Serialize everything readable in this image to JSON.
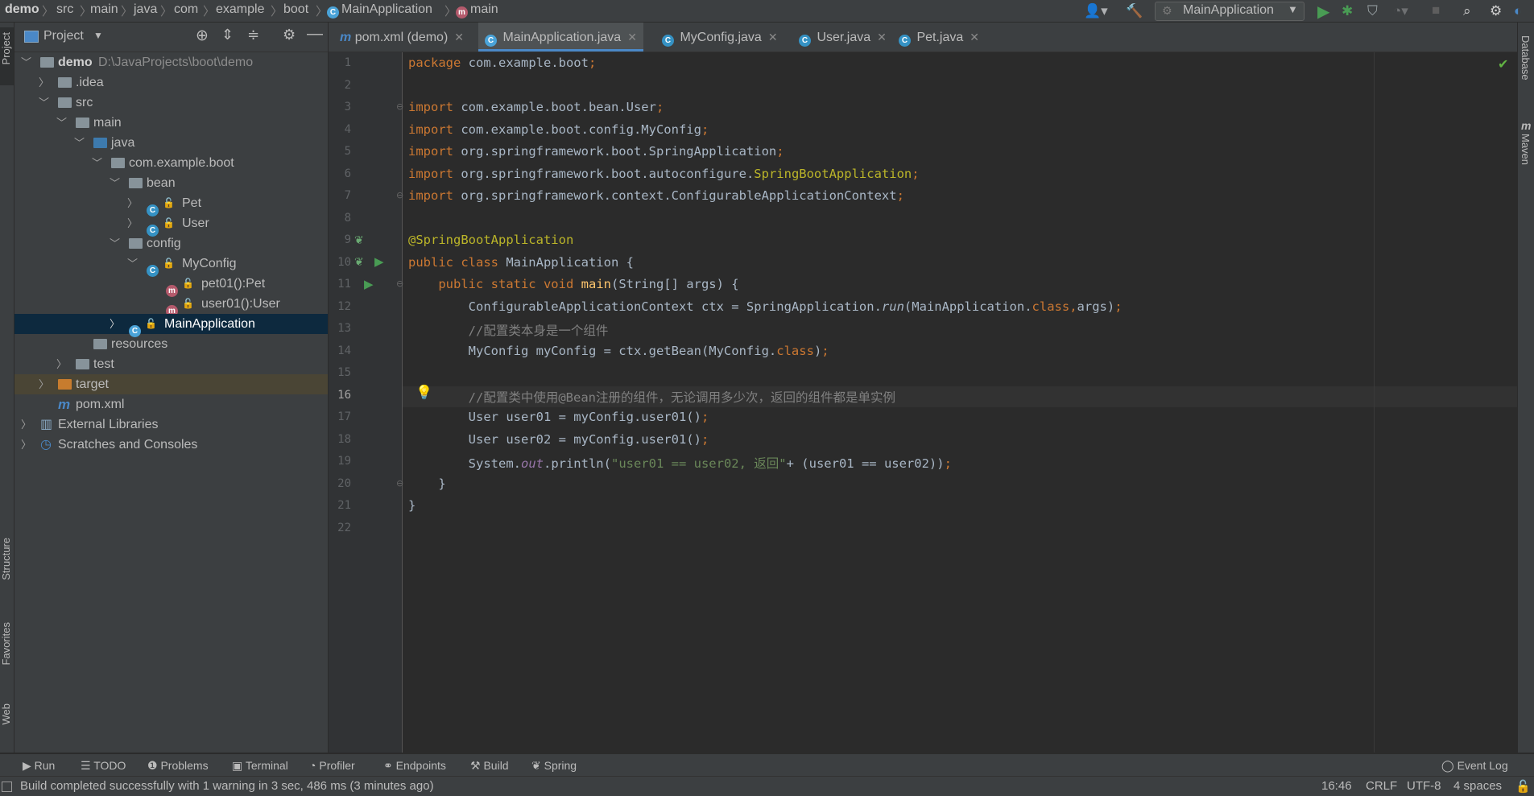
{
  "breadcrumb": {
    "items": [
      "demo",
      "src",
      "main",
      "java",
      "com",
      "example",
      "boot",
      "MainApplication",
      "main"
    ]
  },
  "toolbar": {
    "run_config": "MainApplication"
  },
  "project_panel": {
    "title": "Project",
    "tree": [
      {
        "label": "demo",
        "path": "D:\\JavaProjects\\boot\\demo"
      },
      {
        "label": ".idea"
      },
      {
        "label": "src"
      },
      {
        "label": "main"
      },
      {
        "label": "java"
      },
      {
        "label": "com.example.boot"
      },
      {
        "label": "bean"
      },
      {
        "label": "Pet"
      },
      {
        "label": "User"
      },
      {
        "label": "config"
      },
      {
        "label": "MyConfig"
      },
      {
        "label": "pet01():Pet"
      },
      {
        "label": "user01():User"
      },
      {
        "label": "MainApplication"
      },
      {
        "label": "resources"
      },
      {
        "label": "test"
      },
      {
        "label": "target"
      },
      {
        "label": "pom.xml"
      },
      {
        "label": "External Libraries"
      },
      {
        "label": "Scratches and Consoles"
      }
    ]
  },
  "tabs": [
    {
      "label": "pom.xml (demo)"
    },
    {
      "label": "MainApplication.java"
    },
    {
      "label": "MyConfig.java"
    },
    {
      "label": "User.java"
    },
    {
      "label": "Pet.java"
    }
  ],
  "editor": {
    "line_numbers": [
      "1",
      "2",
      "3",
      "4",
      "5",
      "6",
      "7",
      "8",
      "9",
      "10",
      "11",
      "12",
      "13",
      "14",
      "15",
      "16",
      "17",
      "18",
      "19",
      "20",
      "21",
      "22"
    ],
    "current_line": "16"
  },
  "side_tools": {
    "left": [
      "Project",
      "Structure",
      "Favorites",
      "Web"
    ],
    "right": [
      "Database",
      "Maven"
    ]
  },
  "bottom_tabs": [
    "Run",
    "TODO",
    "Problems",
    "Terminal",
    "Profiler",
    "Endpoints",
    "Build",
    "Spring"
  ],
  "event_log": "Event Log",
  "status": {
    "message": "Build completed successfully with 1 warning in 3 sec, 486 ms (3 minutes ago)",
    "position": "16:46",
    "line_sep": "CRLF",
    "encoding": "UTF-8",
    "indent": "4 spaces"
  },
  "colors": {
    "accent": "#4a88c7",
    "selection": "#0d293e",
    "run_green": "#499c54"
  }
}
